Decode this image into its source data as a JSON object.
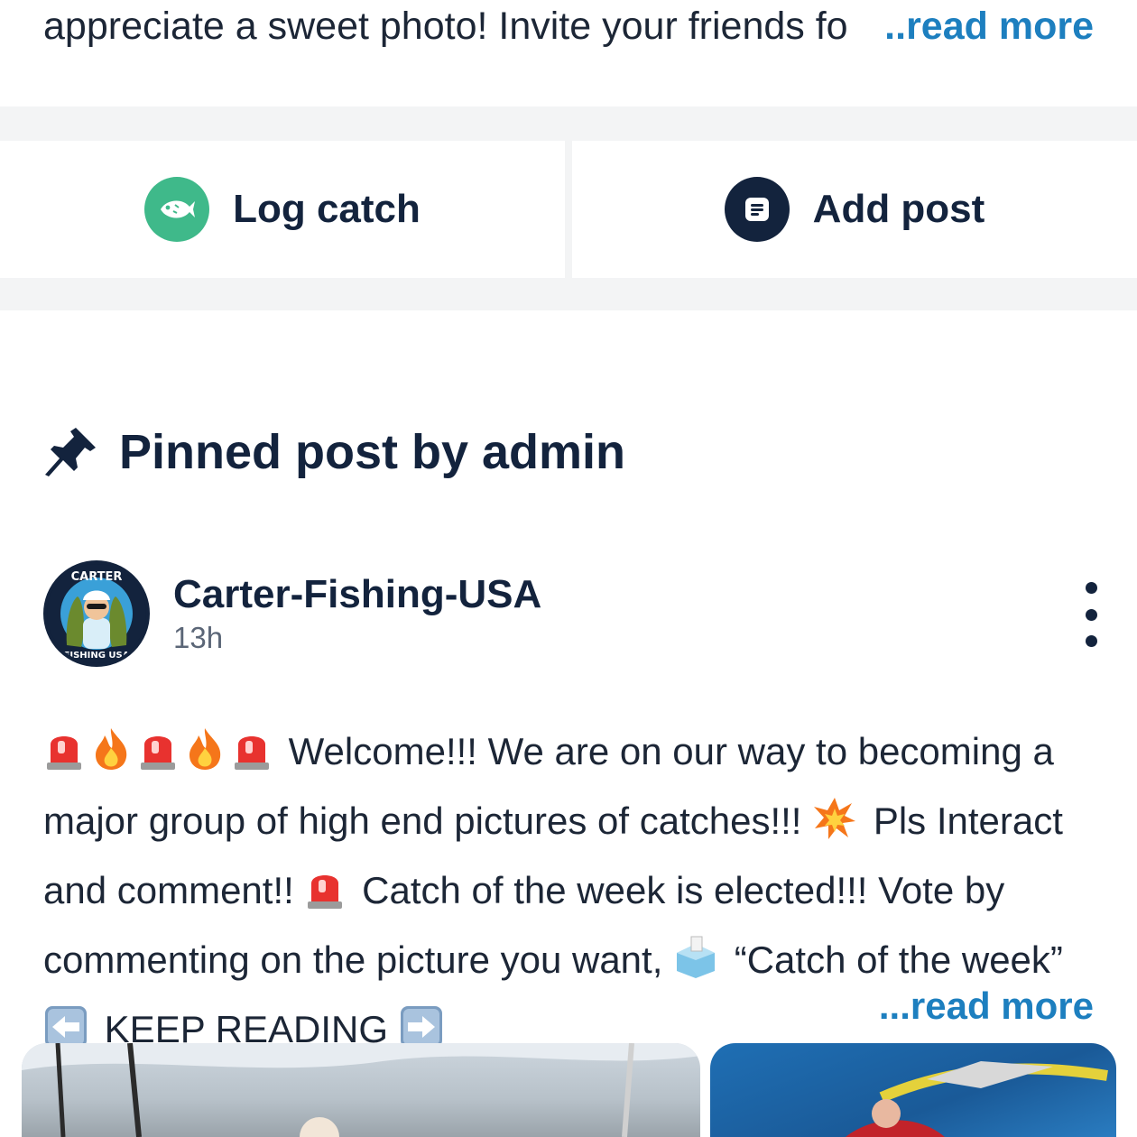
{
  "group_description": {
    "tail_text": "appreciate a sweet photo! Invite your friends fo",
    "read_more_label": "..read more"
  },
  "actions": {
    "log_catch_label": "Log catch",
    "add_post_label": "Add post"
  },
  "pinned_section": {
    "title": "Pinned post by admin"
  },
  "post": {
    "author": "Carter-Fishing-USA",
    "time": "13h",
    "text_line1": "Welcome!!! We are on our way to becoming",
    "text_line2": "a major group of high end pictures of catches!!!",
    "text_line2b": "Pls",
    "text_line3": "Interact and comment!!",
    "text_line3b": "Catch of the week is elected!!!",
    "text_line4": "Vote by commenting on the picture you want,",
    "text_line4b": "“Catch",
    "text_line5": "of the week”",
    "text_line5b": "KEEP READING",
    "read_more_label": "...read more",
    "avatar_top_text": "CARTER",
    "avatar_bottom_text": "FISHING USA"
  },
  "colors": {
    "navy": "#13233d",
    "green": "#3fb98a",
    "link_blue": "#1d7fbf",
    "divider_gray": "#f3f4f5"
  },
  "icons": [
    "fish-icon",
    "post-icon",
    "pin-icon",
    "more-vertical-icon",
    "siren-emoji",
    "fire-emoji",
    "collision-emoji",
    "ballot-box-emoji",
    "left-arrow-emoji",
    "right-arrow-emoji"
  ]
}
